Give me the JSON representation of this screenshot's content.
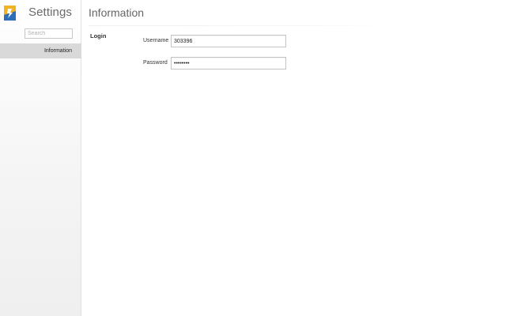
{
  "sidebar": {
    "title": "Settings",
    "search": {
      "placeholder": "Search",
      "value": ""
    },
    "items": [
      {
        "label": "Information",
        "selected": true
      }
    ]
  },
  "main": {
    "title": "Information",
    "section": {
      "label": "Login",
      "fields": {
        "username": {
          "label": "Username",
          "value": "303396"
        },
        "password": {
          "label": "Password",
          "value": "••••••••"
        }
      }
    }
  },
  "colors": {
    "sidebar_bg": "#f4f4f4",
    "selected_item_bg": "#d9d9d9",
    "title_text": "#666666"
  },
  "icons": {
    "logo": "app-logo-icon"
  }
}
